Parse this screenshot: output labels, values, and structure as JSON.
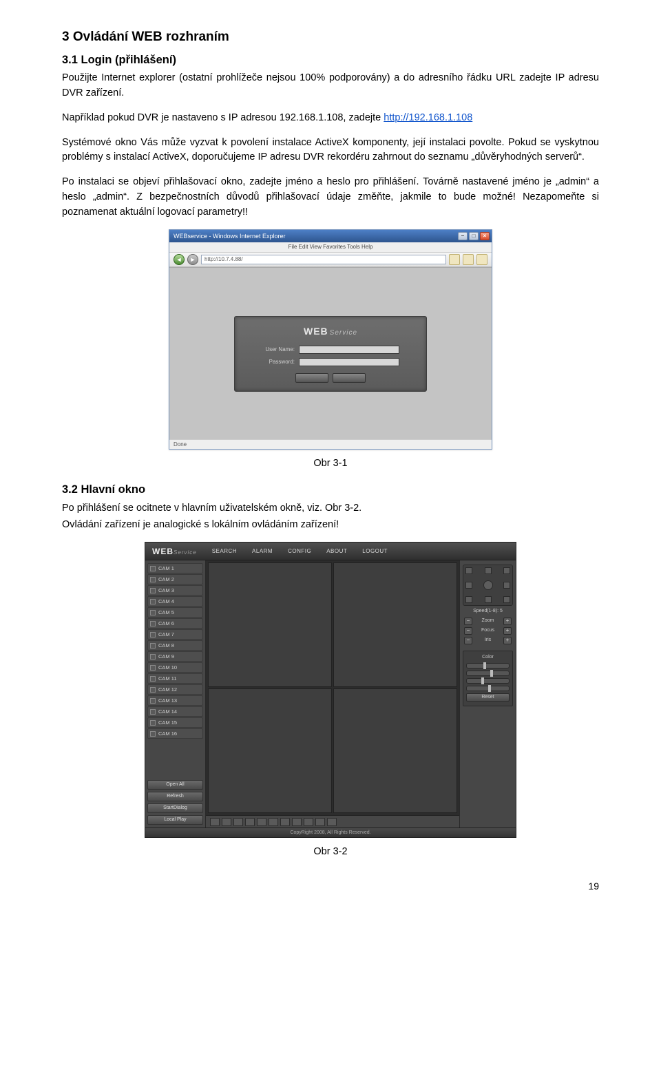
{
  "h1": "3  Ovládání WEB rozhraním",
  "h2_1": "3.1  Login (přihlášení)",
  "p1": "Použijte Internet explorer (ostatní prohlížeče nejsou 100% podporovány) a do adresního řádku URL zadejte IP adresu DVR zařízení.",
  "p2_a": "Například pokud DVR je nastaveno s IP adresou 192.168.1.108, zadejte ",
  "p2_link": "http://192.168.1.108",
  "p3": "Systémové okno Vás může vyzvat k povolení instalace ActiveX komponenty, její instalaci povolte. Pokud se vyskytnou problémy s instalací ActiveX, doporučujeme IP adresu DVR rekordéru zahrnout do seznamu „důvěryhodných serverů“.",
  "p4": "Po instalaci se objeví přihlašovací okno, zadejte jméno a heslo pro přihlášení. Továrně nastavené jméno je „admin“ a heslo „admin“. Z bezpečnostních důvodů přihlašovací údaje změňte, jakmile to bude možné! Nezapomeňte si poznamenat aktuální logovací parametry!!",
  "cap1": "Obr 3-1",
  "h2_2": "3.2  Hlavní okno",
  "p5": "Po přihlášení se ocitnete v hlavním uživatelském okně, viz. Obr 3-2.",
  "p6": "Ovládání zařízení je analogické s lokálním ovládáním zařízení!",
  "cap2": "Obr 3-2",
  "page_num": "19",
  "fig1": {
    "title": "WEBservice - Windows Internet Explorer",
    "menubar": "File   Edit   View   Favorites   Tools   Help",
    "address": "http://10.7.4.88/",
    "brand": "WEB",
    "brand_sub": "Service",
    "user_lbl": "User Name:",
    "pass_lbl": "Password:",
    "status": "Done"
  },
  "fig2": {
    "brand": "WEB",
    "brand_sub": "Service",
    "nav": [
      "SEARCH",
      "ALARM",
      "CONFIG",
      "ABOUT",
      "LOGOUT"
    ],
    "cams": [
      "CAM 1",
      "CAM 2",
      "CAM 3",
      "CAM 4",
      "CAM 5",
      "CAM 6",
      "CAM 7",
      "CAM 8",
      "CAM 9",
      "CAM 10",
      "CAM 11",
      "CAM 12",
      "CAM 13",
      "CAM 14",
      "CAM 15",
      "CAM 16"
    ],
    "left_buttons": [
      "Open All",
      "Refresh",
      "StartDialog",
      "Local Play"
    ],
    "ptz_speed": "Speed(1-8): 5",
    "ptz_rows": [
      "Zoom",
      "Focus",
      "Iris"
    ],
    "color_lbl": "Color",
    "reset_lbl": "Reset",
    "footer": "CopyRight 2008, All Rights Reserved."
  }
}
